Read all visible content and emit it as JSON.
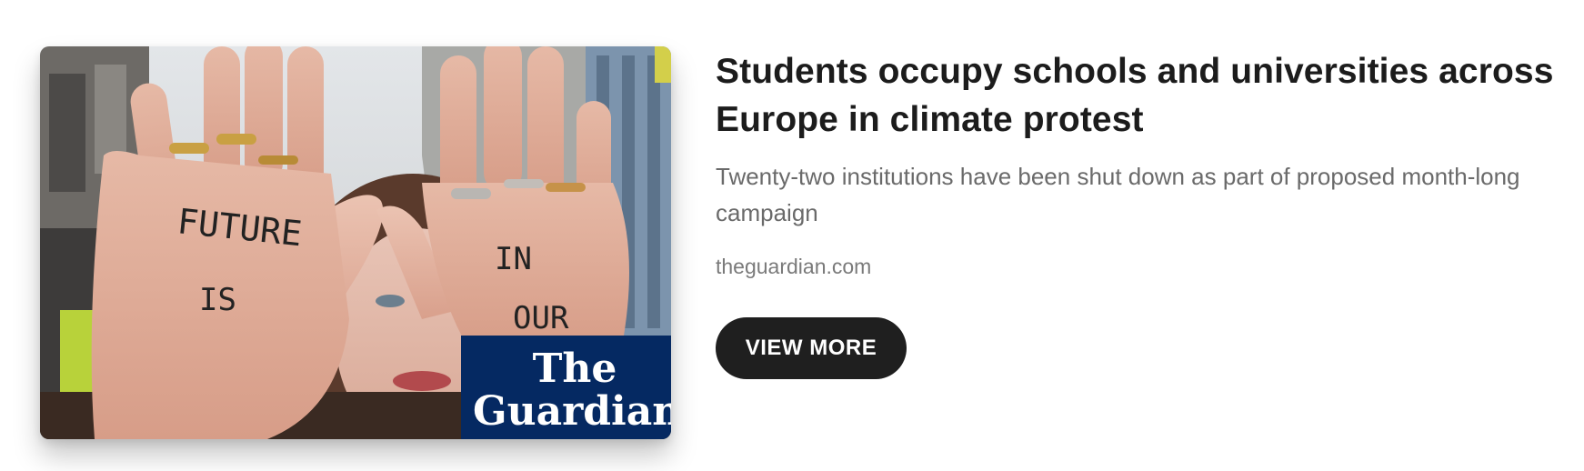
{
  "article": {
    "headline": "Students occupy schools and universities across Europe in climate protest",
    "summary": "Twenty-two institutions have been shut down as part of proposed month-long campaign",
    "source": "theguardian.com",
    "button_label": "VIEW MORE"
  },
  "thumbnail": {
    "hand_text_left": [
      "FUTURE",
      "IS"
    ],
    "hand_text_right": [
      "IN",
      "OUR"
    ],
    "logo_lines": [
      "The",
      "Guardian"
    ],
    "logo_color": "#052962"
  }
}
